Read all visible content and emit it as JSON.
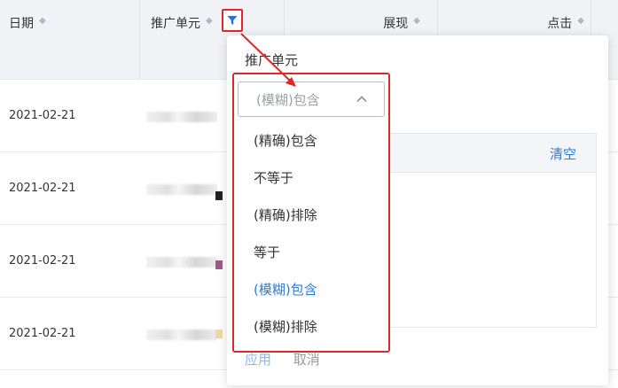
{
  "table": {
    "headers": {
      "date": "日期",
      "unit": "推广单元",
      "impressions": "展现",
      "clicks": "点击"
    },
    "rows": [
      {
        "date": "2021-02-21"
      },
      {
        "date": "2021-02-21"
      },
      {
        "date": "2021-02-21"
      },
      {
        "date": "2021-02-21"
      }
    ]
  },
  "popover": {
    "title": "推广单元",
    "clear_label": "清空",
    "apply_label": "应用",
    "cancel_label": "取消"
  },
  "match_select": {
    "selected": "(模糊)包含",
    "options": [
      {
        "label": "(精确)包含"
      },
      {
        "label": "不等于"
      },
      {
        "label": "(精确)排除"
      },
      {
        "label": "等于"
      },
      {
        "label": "(模糊)包含",
        "active": true
      },
      {
        "label": "(模糊)排除"
      }
    ]
  },
  "colors": {
    "accent": "#2f7bd9",
    "highlight": "#e0262b",
    "header_bg": "#f0f2f5"
  }
}
